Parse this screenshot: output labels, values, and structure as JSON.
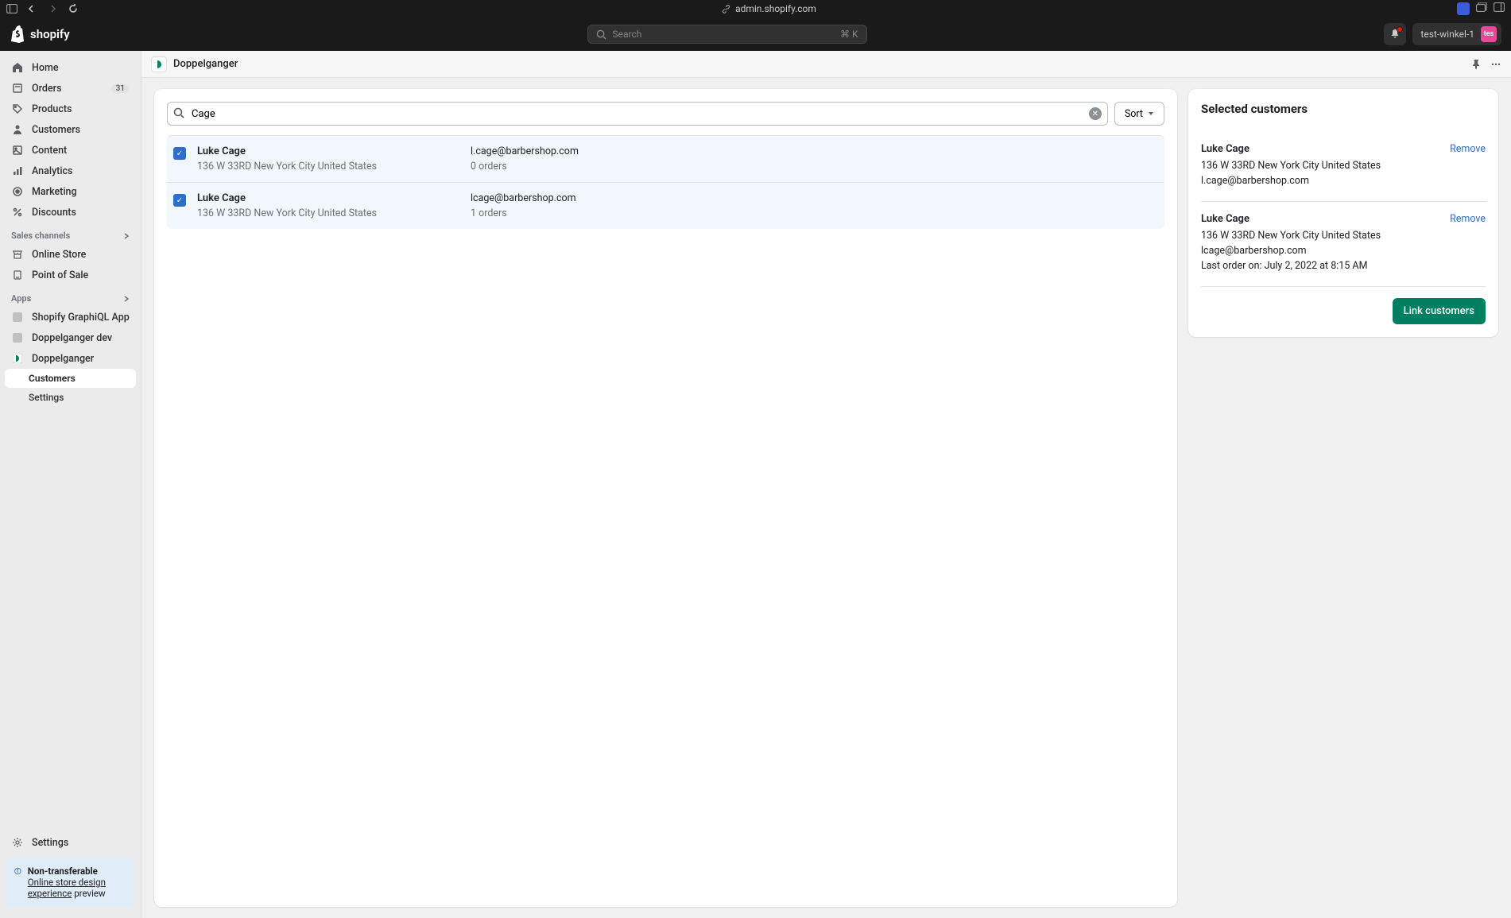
{
  "browser": {
    "url": "admin.shopify.com"
  },
  "topbar": {
    "brand": "shopify",
    "search_placeholder": "Search",
    "search_shortcut": "⌘ K",
    "store_name": "test-winkel-1",
    "avatar_initials": "tes"
  },
  "sidebar": {
    "nav": [
      {
        "label": "Home",
        "icon": "home"
      },
      {
        "label": "Orders",
        "icon": "orders",
        "badge": "31"
      },
      {
        "label": "Products",
        "icon": "products"
      },
      {
        "label": "Customers",
        "icon": "customers"
      },
      {
        "label": "Content",
        "icon": "content"
      },
      {
        "label": "Analytics",
        "icon": "analytics"
      },
      {
        "label": "Marketing",
        "icon": "marketing"
      },
      {
        "label": "Discounts",
        "icon": "discounts"
      }
    ],
    "channels_label": "Sales channels",
    "channels": [
      {
        "label": "Online Store"
      },
      {
        "label": "Point of Sale"
      }
    ],
    "apps_label": "Apps",
    "apps": [
      {
        "label": "Shopify GraphiQL App"
      },
      {
        "label": "Doppelganger dev"
      },
      {
        "label": "Doppelganger",
        "sub": [
          {
            "label": "Customers",
            "active": true
          },
          {
            "label": "Settings"
          }
        ]
      }
    ],
    "settings_label": "Settings",
    "info": {
      "title": "Non-transferable",
      "link_text": "Online store design experience",
      "suffix": " preview"
    }
  },
  "page": {
    "app_name": "Doppelganger"
  },
  "search": {
    "value": "Cage",
    "sort_label": "Sort"
  },
  "results": [
    {
      "checked": true,
      "name": "Luke Cage",
      "address": "136 W 33RD New York City United States",
      "email": "l.cage@barbershop.com",
      "orders": "0 orders"
    },
    {
      "checked": true,
      "name": "Luke Cage",
      "address": "136 W 33RD New York City United States",
      "email": "lcage@barbershop.com",
      "orders": "1 orders"
    }
  ],
  "selected": {
    "title": "Selected customers",
    "items": [
      {
        "name": "Luke Cage",
        "address": "136 W 33RD New York City United States",
        "email": "l.cage@barbershop.com",
        "extra": null
      },
      {
        "name": "Luke Cage",
        "address": "136 W 33RD New York City United States",
        "email": "lcage@barbershop.com",
        "extra": "Last order on: July 2, 2022 at 8:15 AM"
      }
    ],
    "remove_label": "Remove",
    "link_button": "Link customers"
  }
}
